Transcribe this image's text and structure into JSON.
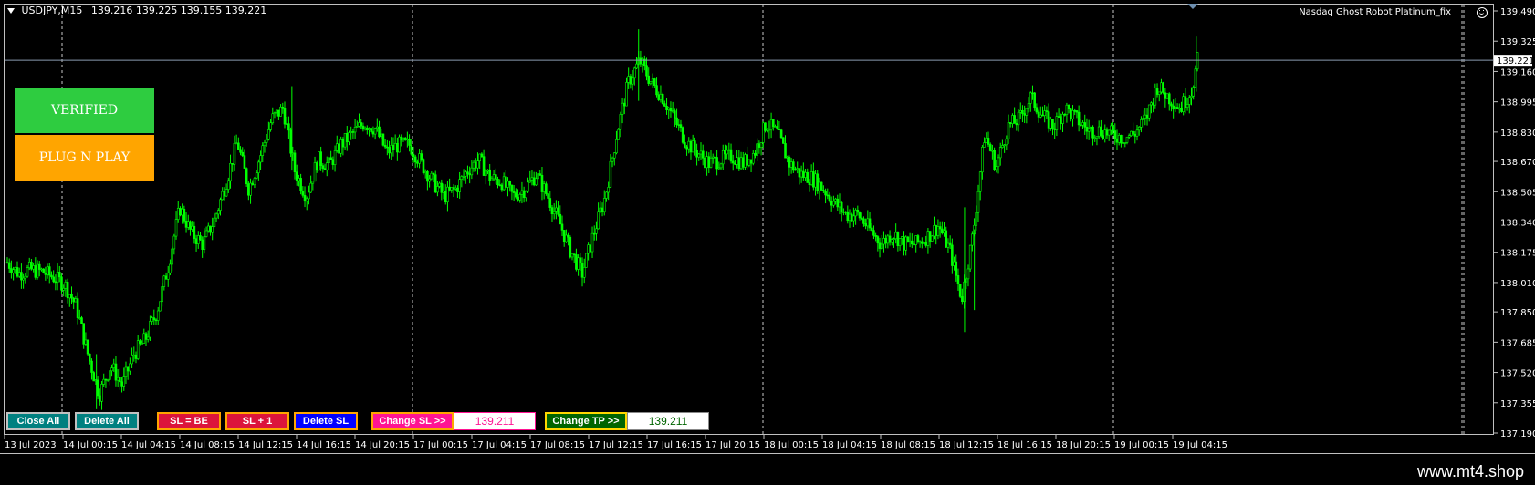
{
  "header": {
    "symbol_timeframe": "USDJPY,M15",
    "ohlc": "139.216 139.225 139.155 139.221"
  },
  "robot_label": "Nasdaq Ghost Robot Platinum_fix",
  "badges": {
    "verified": "VERIFIED",
    "plug_n_play": "PLUG N PLAY"
  },
  "buttons": {
    "close_all": "Close All",
    "delete_all": "Delete All",
    "sl_be": "SL = BE",
    "sl_plus_one": "SL + 1",
    "delete_sl": "Delete SL",
    "change_sl": "Change SL >>",
    "sl_value": "139.211",
    "change_tp": "Change TP >>",
    "tp_value": "139.211"
  },
  "watermark": "www.mt4.shop",
  "colors": {
    "background": "#000000",
    "candles": "#00ff00",
    "verified_bg": "#2ecc40",
    "plug_bg": "#ffa500",
    "teal_btn": "#008080",
    "red_btn": "#dc143c",
    "blue_btn": "#0000ff",
    "pink_btn": "#ff1493",
    "green_btn": "#006400"
  },
  "chart_data": {
    "type": "line",
    "series_style": "candlestick",
    "symbol": "USDJPY",
    "timeframe": "M15",
    "y_ticks": [
      "139.490",
      "139.325",
      "139.160",
      "138.995",
      "138.830",
      "138.670",
      "138.505",
      "138.340",
      "138.175",
      "138.010",
      "137.850",
      "137.685",
      "137.520",
      "137.355",
      "137.190"
    ],
    "ylim": [
      137.19,
      139.49
    ],
    "current_price": "139.221",
    "x_ticks": [
      "13 Jul 2023",
      "14 Jul 00:15",
      "14 Jul 04:15",
      "14 Jul 08:15",
      "14 Jul 12:15",
      "14 Jul 16:15",
      "14 Jul 20:15",
      "17 Jul 00:15",
      "17 Jul 04:15",
      "17 Jul 08:15",
      "17 Jul 12:15",
      "17 Jul 16:15",
      "17 Jul 20:15",
      "18 Jul 00:15",
      "18 Jul 04:15",
      "18 Jul 08:15",
      "18 Jul 12:15",
      "18 Jul 16:15",
      "18 Jul 20:15",
      "19 Jul 00:15",
      "19 Jul 04:15"
    ],
    "price_path": [
      [
        0,
        138.12
      ],
      [
        2,
        138.06
      ],
      [
        4,
        138.08
      ],
      [
        6,
        138.07
      ],
      [
        8,
        138.04
      ],
      [
        10,
        138.0
      ],
      [
        12,
        137.88
      ],
      [
        14,
        137.62
      ],
      [
        16,
        137.4
      ],
      [
        18,
        137.56
      ],
      [
        20,
        137.45
      ],
      [
        22,
        137.62
      ],
      [
        24,
        137.7
      ],
      [
        26,
        137.85
      ],
      [
        28,
        138.1
      ],
      [
        30,
        138.42
      ],
      [
        32,
        138.28
      ],
      [
        34,
        138.22
      ],
      [
        36,
        138.35
      ],
      [
        38,
        138.55
      ],
      [
        40,
        138.78
      ],
      [
        42,
        138.52
      ],
      [
        44,
        138.7
      ],
      [
        46,
        138.9
      ],
      [
        48,
        138.96
      ],
      [
        50,
        138.62
      ],
      [
        52,
        138.48
      ],
      [
        54,
        138.68
      ],
      [
        56,
        138.65
      ],
      [
        58,
        138.76
      ],
      [
        60,
        138.82
      ],
      [
        62,
        138.88
      ],
      [
        64,
        138.85
      ],
      [
        66,
        138.72
      ],
      [
        68,
        138.76
      ],
      [
        70,
        138.76
      ],
      [
        72,
        138.66
      ],
      [
        74,
        138.56
      ],
      [
        76,
        138.48
      ],
      [
        78,
        138.52
      ],
      [
        80,
        138.62
      ],
      [
        82,
        138.68
      ],
      [
        84,
        138.58
      ],
      [
        86,
        138.56
      ],
      [
        88,
        138.48
      ],
      [
        90,
        138.52
      ],
      [
        92,
        138.6
      ],
      [
        94,
        138.48
      ],
      [
        96,
        138.34
      ],
      [
        98,
        138.18
      ],
      [
        100,
        138.06
      ],
      [
        102,
        138.28
      ],
      [
        104,
        138.48
      ],
      [
        106,
        138.82
      ],
      [
        108,
        139.1
      ],
      [
        110,
        139.22
      ],
      [
        112,
        139.1
      ],
      [
        114,
        139.02
      ],
      [
        116,
        138.9
      ],
      [
        118,
        138.78
      ],
      [
        120,
        138.72
      ],
      [
        122,
        138.66
      ],
      [
        124,
        138.68
      ],
      [
        126,
        138.7
      ],
      [
        128,
        138.66
      ],
      [
        130,
        138.72
      ],
      [
        132,
        138.88
      ],
      [
        134,
        138.82
      ],
      [
        136,
        138.66
      ],
      [
        138,
        138.6
      ],
      [
        140,
        138.58
      ],
      [
        142,
        138.52
      ],
      [
        144,
        138.44
      ],
      [
        146,
        138.38
      ],
      [
        148,
        138.38
      ],
      [
        150,
        138.3
      ],
      [
        152,
        138.22
      ],
      [
        154,
        138.28
      ],
      [
        156,
        138.22
      ],
      [
        158,
        138.22
      ],
      [
        160,
        138.26
      ],
      [
        162,
        138.32
      ],
      [
        164,
        138.18
      ],
      [
        166,
        137.92
      ],
      [
        168,
        138.28
      ],
      [
        170,
        138.82
      ],
      [
        172,
        138.64
      ],
      [
        174,
        138.86
      ],
      [
        176,
        138.9
      ],
      [
        178,
        139.02
      ],
      [
        180,
        138.92
      ],
      [
        182,
        138.86
      ],
      [
        184,
        138.96
      ],
      [
        186,
        138.9
      ],
      [
        188,
        138.84
      ],
      [
        190,
        138.84
      ],
      [
        192,
        138.82
      ],
      [
        194,
        138.8
      ],
      [
        196,
        138.82
      ],
      [
        198,
        138.9
      ],
      [
        200,
        139.08
      ],
      [
        202,
        139.02
      ],
      [
        204,
        138.96
      ],
      [
        206,
        139.06
      ],
      [
        207,
        139.22
      ]
    ]
  }
}
